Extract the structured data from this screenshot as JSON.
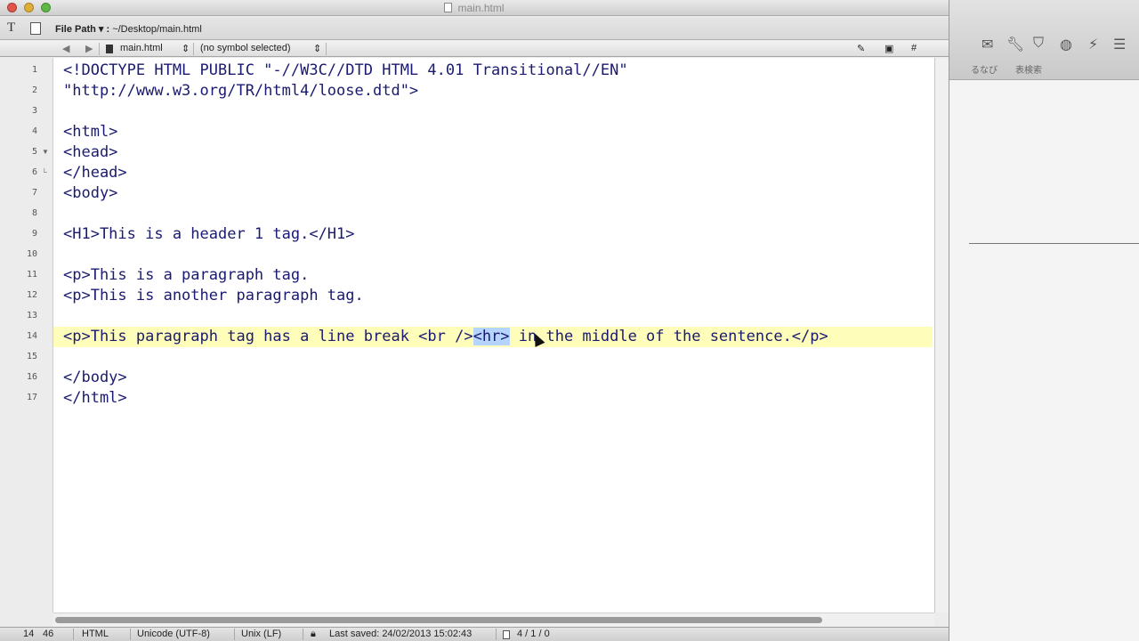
{
  "window": {
    "title": "main.html",
    "toolbar": {
      "text_tool_glyph": "T",
      "file_path_label": "File Path ▾ :",
      "file_path_value": "~/Desktop/main.html"
    },
    "nav": {
      "back": "◀",
      "forward": "▶",
      "file_menu": "main.html",
      "symbol_menu": "(no symbol selected)"
    }
  },
  "editor": {
    "lines": [
      {
        "n": "1",
        "text": "<!DOCTYPE HTML PUBLIC \"-//W3C//DTD HTML 4.01 Transitional//EN\""
      },
      {
        "n": "2",
        "text": "\"http://www.w3.org/TR/html4/loose.dtd\">"
      },
      {
        "n": "3",
        "text": ""
      },
      {
        "n": "4",
        "text": "<html>"
      },
      {
        "n": "5",
        "text": "<head>"
      },
      {
        "n": "6",
        "text": "</head>"
      },
      {
        "n": "7",
        "text": "<body>"
      },
      {
        "n": "8",
        "text": ""
      },
      {
        "n": "9",
        "text": "<H1>This is a header 1 tag.</H1>"
      },
      {
        "n": "10",
        "text": ""
      },
      {
        "n": "11",
        "text": "<p>This is a paragraph tag."
      },
      {
        "n": "12",
        "text": "<p>This is another paragraph tag."
      },
      {
        "n": "13",
        "text": ""
      },
      {
        "n": "14",
        "text_before": "<p>This paragraph tag has a line break <br />",
        "selected": "<hr>",
        "text_after": " in the middle of the sentence.</p>"
      },
      {
        "n": "15",
        "text": ""
      },
      {
        "n": "16",
        "text": "</body>"
      },
      {
        "n": "17",
        "text": "</html>"
      }
    ],
    "current_line": 14
  },
  "statusbar": {
    "line": "14",
    "column": "46",
    "language": "HTML",
    "encoding": "Unicode (UTF-8)",
    "line_endings": "Unix (LF)",
    "last_saved": "Last saved: 24/02/2013 15:02:43",
    "stats": "4 / 1 / 0"
  },
  "right_panel": {
    "label": "るなび　　表検索"
  }
}
